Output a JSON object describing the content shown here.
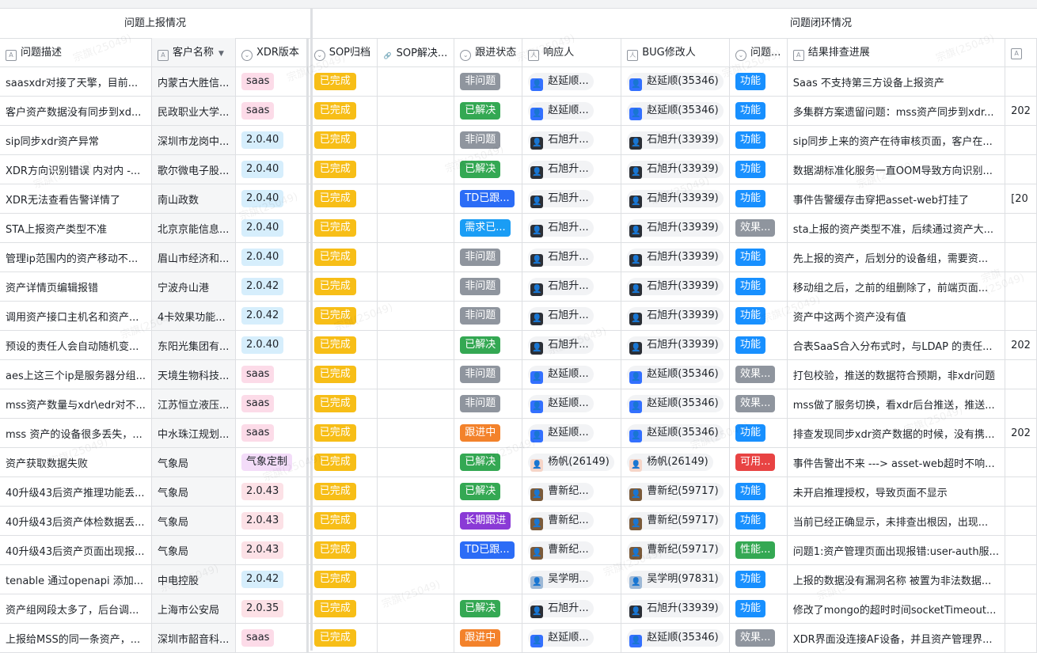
{
  "groups": {
    "left": "问题上报情况",
    "right": "问题闭环情况"
  },
  "columns": {
    "desc": "问题描述",
    "customer": "客户名称",
    "xdr": "XDR版本",
    "sop": "SOP归档",
    "sopsol": "SOP解决...",
    "status": "跟进状态",
    "resp": "响应人",
    "bugfix": "BUG修改人",
    "problem": "问题...",
    "result": "结果排查进展"
  },
  "colors": {
    "sop": "#f7be17",
    "accent": "#1890ff"
  },
  "watermark": "宗旗(25049)",
  "rows": [
    {
      "desc": "saasxdr对接了天擎，目前...",
      "customer": "内蒙古大胜信...",
      "xdr": "saas",
      "xdr_style": "saas",
      "sop": "已完成",
      "status": "非问题",
      "st": "gray",
      "resp": "赵延顺...",
      "resp_av": "blue",
      "bug": "赵延顺(35346)",
      "bug_av": "blue",
      "ptype": "功能",
      "pt": "blue",
      "result": "Saas 不支持第三方设备上报资产",
      "extra": ""
    },
    {
      "desc": "客户资产数据没有同步到xd...",
      "customer": "民政职业大学...",
      "xdr": "saas",
      "xdr_style": "saas",
      "sop": "已完成",
      "status": "已解决",
      "st": "green",
      "resp": "赵延顺...",
      "resp_av": "blue",
      "bug": "赵延顺(35346)",
      "bug_av": "blue",
      "ptype": "功能",
      "pt": "blue",
      "result": "多集群方案遗留问题：mss资产同步到xdr...",
      "extra": "202"
    },
    {
      "desc": "sip同步xdr资产异常",
      "customer": "深圳市龙岗中...",
      "xdr": "2.0.40",
      "xdr_style": "blue",
      "sop": "已完成",
      "status": "非问题",
      "st": "gray",
      "resp": "石旭升...",
      "resp_av": "dark",
      "bug": "石旭升(33939)",
      "bug_av": "dark",
      "ptype": "功能",
      "pt": "blue",
      "result": "sip同步上来的资产在待审核页面，客户在...",
      "extra": ""
    },
    {
      "desc": "XDR方向识别错误 内对内 -...",
      "customer": "歌尔微电子股...",
      "xdr": "2.0.40",
      "xdr_style": "blue",
      "sop": "已完成",
      "status": "已解决",
      "st": "green",
      "resp": "石旭升...",
      "resp_av": "dark",
      "bug": "石旭升(33939)",
      "bug_av": "dark",
      "ptype": "功能",
      "pt": "blue",
      "result": "数据湖标准化服务一直OOM导致方向识别...",
      "extra": ""
    },
    {
      "desc": "XDR无法查看告警详情了",
      "customer": "南山政数",
      "xdr": "2.0.40",
      "xdr_style": "blue",
      "sop": "已完成",
      "status": "TD已跟...",
      "st": "blue",
      "resp": "石旭升...",
      "resp_av": "dark",
      "bug": "石旭升(33939)",
      "bug_av": "dark",
      "ptype": "功能",
      "pt": "blue",
      "result": "事件告警缓存击穿把asset-web打挂了",
      "extra": "[20"
    },
    {
      "desc": "STA上报资产类型不准",
      "customer": "北京京能信息...",
      "xdr": "2.0.40",
      "xdr_style": "blue",
      "sop": "已完成",
      "status": "需求已...",
      "st": "cyan",
      "resp": "石旭升...",
      "resp_av": "dark",
      "bug": "石旭升(33939)",
      "bug_av": "dark",
      "ptype": "效果...",
      "pt": "gray",
      "result": "sta上报的资产类型不准，后续通过资产大...",
      "extra": ""
    },
    {
      "desc": "管理ip范围内的资产移动不...",
      "customer": "眉山市经济和...",
      "xdr": "2.0.40",
      "xdr_style": "blue",
      "sop": "已完成",
      "status": "非问题",
      "st": "gray",
      "resp": "石旭升...",
      "resp_av": "dark",
      "bug": "石旭升(33939)",
      "bug_av": "dark",
      "ptype": "功能",
      "pt": "blue",
      "result": "先上报的资产，后划分的设备组，需要资...",
      "extra": ""
    },
    {
      "desc": "资产详情页编辑报错",
      "customer": "宁波舟山港",
      "xdr": "2.0.42",
      "xdr_style": "blue",
      "sop": "已完成",
      "status": "非问题",
      "st": "gray",
      "resp": "石旭升...",
      "resp_av": "dark",
      "bug": "石旭升(33939)",
      "bug_av": "dark",
      "ptype": "功能",
      "pt": "blue",
      "result": "移动组之后，之前的组删除了，前端页面...",
      "extra": ""
    },
    {
      "desc": "调用资产接口主机名和资产...",
      "customer": "4卡效果功能...",
      "xdr": "2.0.42",
      "xdr_style": "blue",
      "sop": "已完成",
      "status": "非问题",
      "st": "gray",
      "resp": "石旭升...",
      "resp_av": "dark",
      "bug": "石旭升(33939)",
      "bug_av": "dark",
      "ptype": "功能",
      "pt": "blue",
      "result": "资产中这两个资产没有值",
      "extra": ""
    },
    {
      "desc": "预设的责任人会自动随机变...",
      "customer": "东阳光集团有...",
      "xdr": "2.0.40",
      "xdr_style": "blue",
      "sop": "已完成",
      "status": "已解决",
      "st": "green",
      "resp": "石旭升...",
      "resp_av": "dark",
      "bug": "石旭升(33939)",
      "bug_av": "dark",
      "ptype": "功能",
      "pt": "blue",
      "result": "合表SaaS合入分布式时，与LDAP 的责任...",
      "extra": "202"
    },
    {
      "desc": "aes上这三个ip是服务器分组...",
      "customer": "天境生物科技...",
      "xdr": "saas",
      "xdr_style": "saas",
      "sop": "已完成",
      "status": "非问题",
      "st": "gray",
      "resp": "赵延顺...",
      "resp_av": "blue",
      "bug": "赵延顺(35346)",
      "bug_av": "blue",
      "ptype": "效果...",
      "pt": "gray",
      "result": "打包校验，推送的数据符合预期，非xdr问题",
      "extra": ""
    },
    {
      "desc": "mss资产数量与xdr\\edr对不...",
      "customer": "江苏恒立液压...",
      "xdr": "saas",
      "xdr_style": "saas",
      "sop": "已完成",
      "status": "非问题",
      "st": "gray",
      "resp": "赵延顺...",
      "resp_av": "blue",
      "bug": "赵延顺(35346)",
      "bug_av": "blue",
      "ptype": "效果...",
      "pt": "gray",
      "result": "mss做了服务切换，看xdr后台推送，推送...",
      "extra": ""
    },
    {
      "desc": "mss 资产的设备很多丢失，...",
      "customer": "中水珠江规划...",
      "xdr": "saas",
      "xdr_style": "saas",
      "sop": "已完成",
      "status": "跟进中",
      "st": "orange",
      "resp": "赵延顺...",
      "resp_av": "blue",
      "bug": "赵延顺(35346)",
      "bug_av": "blue",
      "ptype": "功能",
      "pt": "blue",
      "result": "排查发现同步xdr资产数据的时候，没有携...",
      "extra": "202"
    },
    {
      "desc": "资产获取数据失败",
      "customer": "气象局",
      "xdr": "气象定制",
      "xdr_style": "purple",
      "sop": "已完成",
      "status": "已解决",
      "st": "green",
      "resp": "杨帆(26149)",
      "resp_av": "girl",
      "bug": "杨帆(26149)",
      "bug_av": "girl",
      "ptype": "可用...",
      "pt": "red",
      "result": "事件告警出不来 ---> asset-web超时不响...",
      "extra": ""
    },
    {
      "desc": "40升级43后资产推理功能丢...",
      "customer": "气象局",
      "xdr": "2.0.43",
      "xdr_style": "pink",
      "sop": "已完成",
      "status": "已解决",
      "st": "green",
      "resp": "曹新纪...",
      "resp_av": "brown",
      "bug": "曹新纪(59717)",
      "bug_av": "brown",
      "ptype": "功能",
      "pt": "blue",
      "result": "未开启推理授权，导致页面不显示",
      "extra": ""
    },
    {
      "desc": "40升级43后资产体检数据丢...",
      "customer": "气象局",
      "xdr": "2.0.43",
      "xdr_style": "pink",
      "sop": "已完成",
      "status": "长期跟进",
      "st": "purple",
      "resp": "曹新纪...",
      "resp_av": "brown",
      "bug": "曹新纪(59717)",
      "bug_av": "brown",
      "ptype": "功能",
      "pt": "blue",
      "result": "当前已经正确显示，未排查出根因，出现...",
      "extra": ""
    },
    {
      "desc": "40升级43后资产页面出现报...",
      "customer": "气象局",
      "xdr": "2.0.43",
      "xdr_style": "pink",
      "sop": "已完成",
      "status": "TD已跟...",
      "st": "blue",
      "resp": "曹新纪...",
      "resp_av": "brown",
      "bug": "曹新纪(59717)",
      "bug_av": "brown",
      "ptype": "性能...",
      "pt": "green",
      "result": "问题1:资产管理页面出现报错:user-auth服...",
      "extra": ""
    },
    {
      "desc": "tenable 通过openapi 添加...",
      "customer": "中电控股",
      "xdr": "2.0.42",
      "xdr_style": "blue",
      "sop": "已完成",
      "status": "",
      "st": "",
      "resp": "吴学明...",
      "resp_av": "land",
      "bug": "吴学明(97831)",
      "bug_av": "land",
      "ptype": "功能",
      "pt": "blue",
      "result": "上报的数据没有漏洞名称 被置为非法数据...",
      "extra": ""
    },
    {
      "desc": "资产组网段太多了，后台调...",
      "customer": "上海市公安局",
      "xdr": "2.0.35",
      "xdr_style": "pink",
      "sop": "已完成",
      "status": "已解决",
      "st": "green",
      "resp": "石旭升...",
      "resp_av": "dark",
      "bug": "石旭升(33939)",
      "bug_av": "dark",
      "ptype": "功能",
      "pt": "blue",
      "result": "修改了mongo的超时时间socketTimeout...",
      "extra": ""
    },
    {
      "desc": "上报给MSS的同一条资产，...",
      "customer": "深圳市韶音科...",
      "xdr": "saas",
      "xdr_style": "saas",
      "sop": "已完成",
      "status": "跟进中",
      "st": "orange",
      "resp": "赵延顺...",
      "resp_av": "blue",
      "bug": "赵延顺(35346)",
      "bug_av": "blue",
      "ptype": "效果...",
      "pt": "gray",
      "result": "XDR界面没连接AF设备，并且资产管理界...",
      "extra": ""
    }
  ]
}
